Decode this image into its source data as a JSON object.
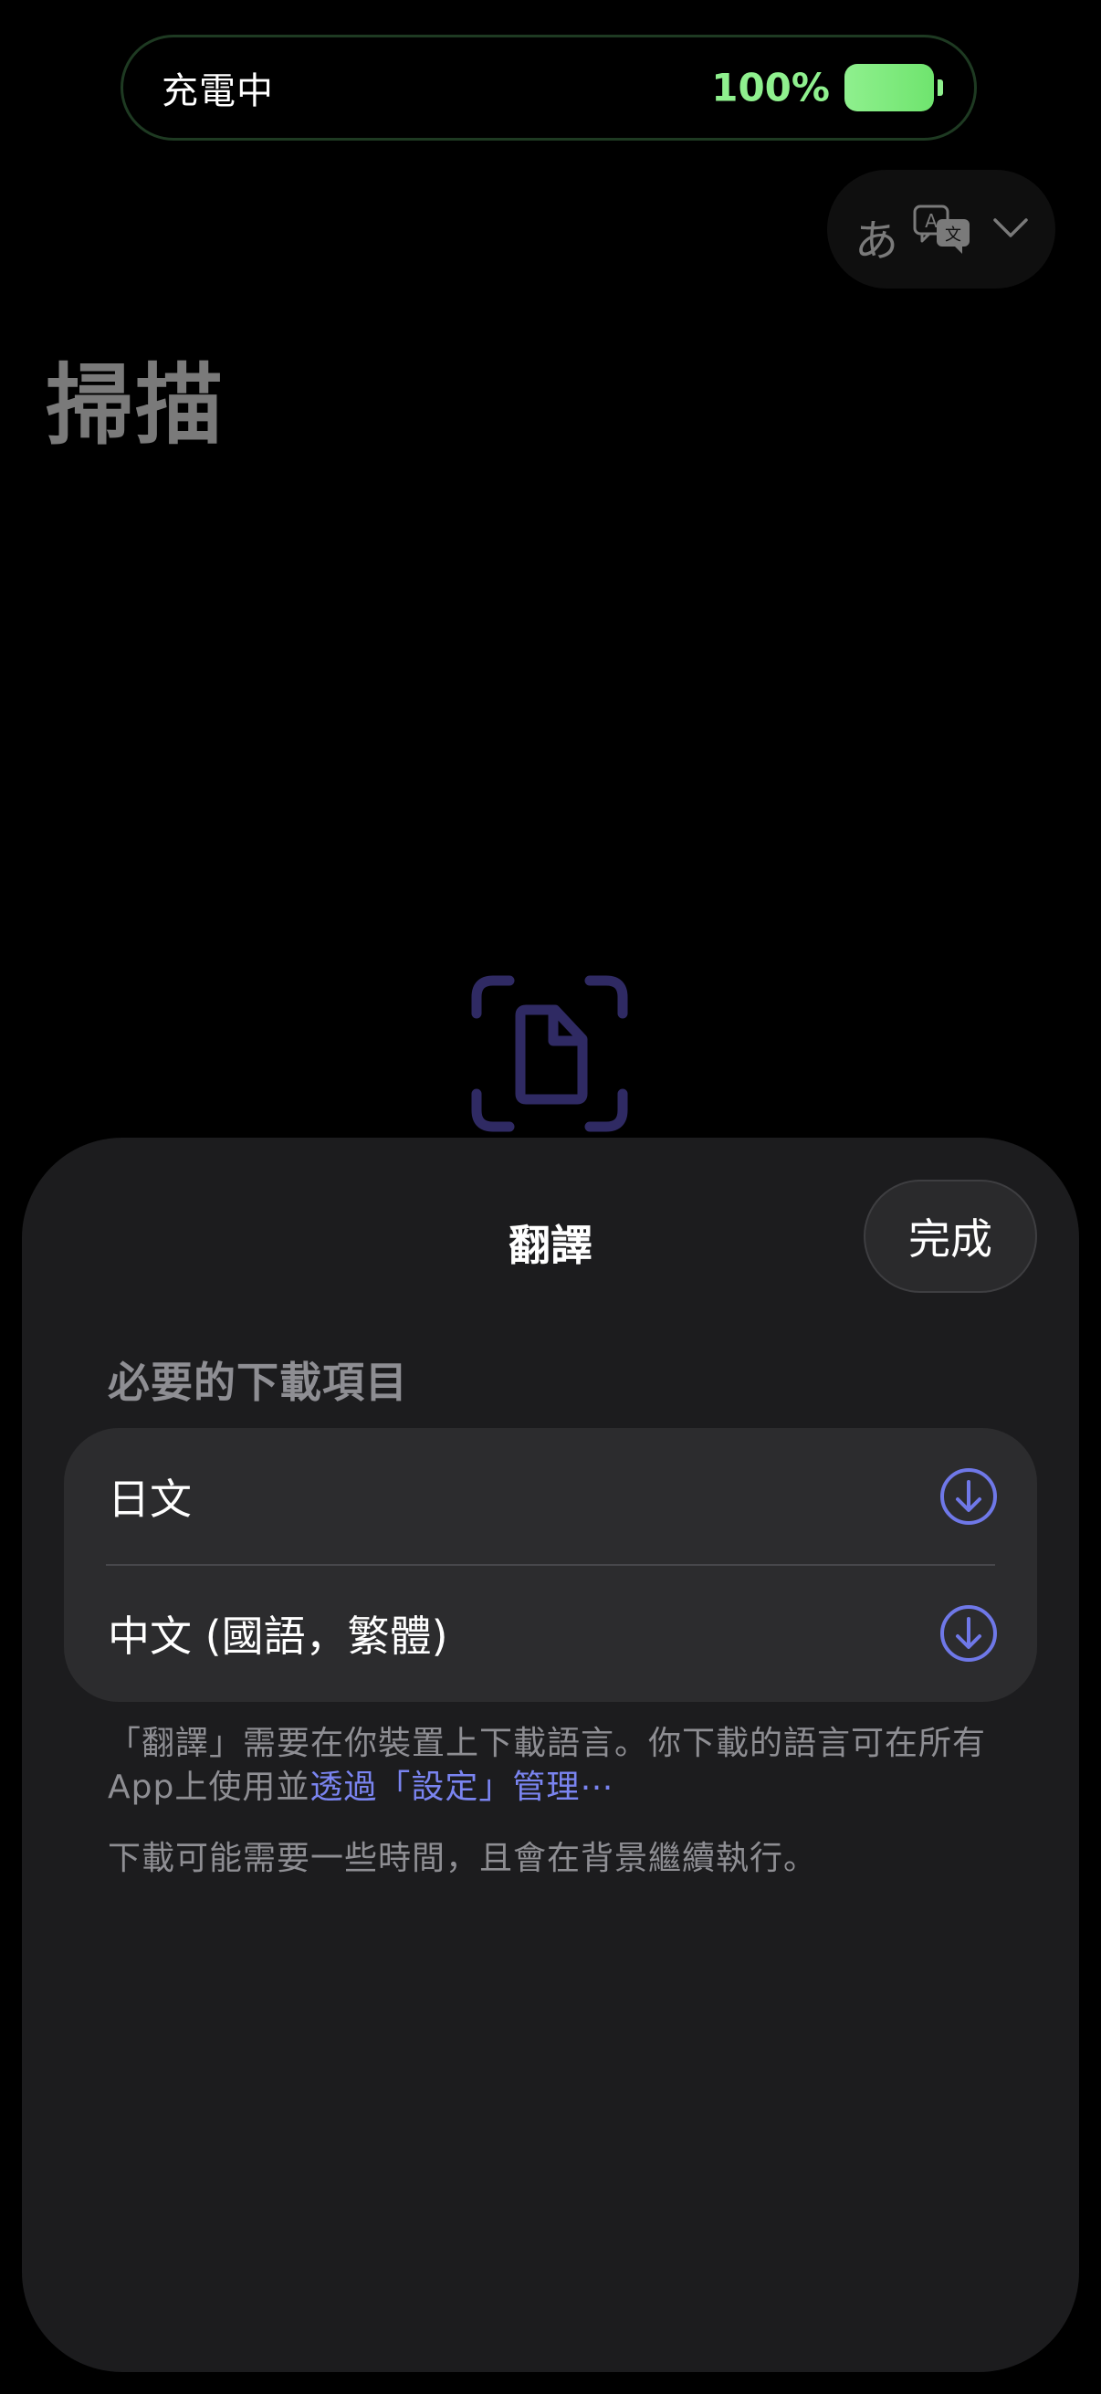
{
  "status": {
    "charging_label": "充電中",
    "battery_percent": "100%",
    "battery_level": 100
  },
  "language_selector": {
    "source_char": "あ",
    "icon": "translate-icon",
    "chevron": "chevron-down-icon"
  },
  "page": {
    "title": "掃描"
  },
  "scan": {
    "icon": "scan-document-icon"
  },
  "sheet": {
    "title": "翻譯",
    "done_label": "完成",
    "section_header": "必要的下載項目",
    "items": [
      {
        "label": "日文",
        "icon": "download-icon"
      },
      {
        "label": "中文 (國語，繁體)",
        "icon": "download-icon"
      }
    ],
    "footnote_text": "「翻譯」需要在你裝置上下載語言。你下載的語言可在所有App上使用並",
    "footnote_link": "透過「設定」管理⋯",
    "footnote_2": "下載可能需要一些時間，且會在背景繼續執行。"
  },
  "colors": {
    "background": "#000000",
    "sheet": "#1c1c1e",
    "list_group": "#2c2c2e",
    "battery_green": "#8ff08e",
    "accent": "#6f78e8",
    "scan_icon": "#2f2a63",
    "secondary_text": "#8e8e93"
  }
}
